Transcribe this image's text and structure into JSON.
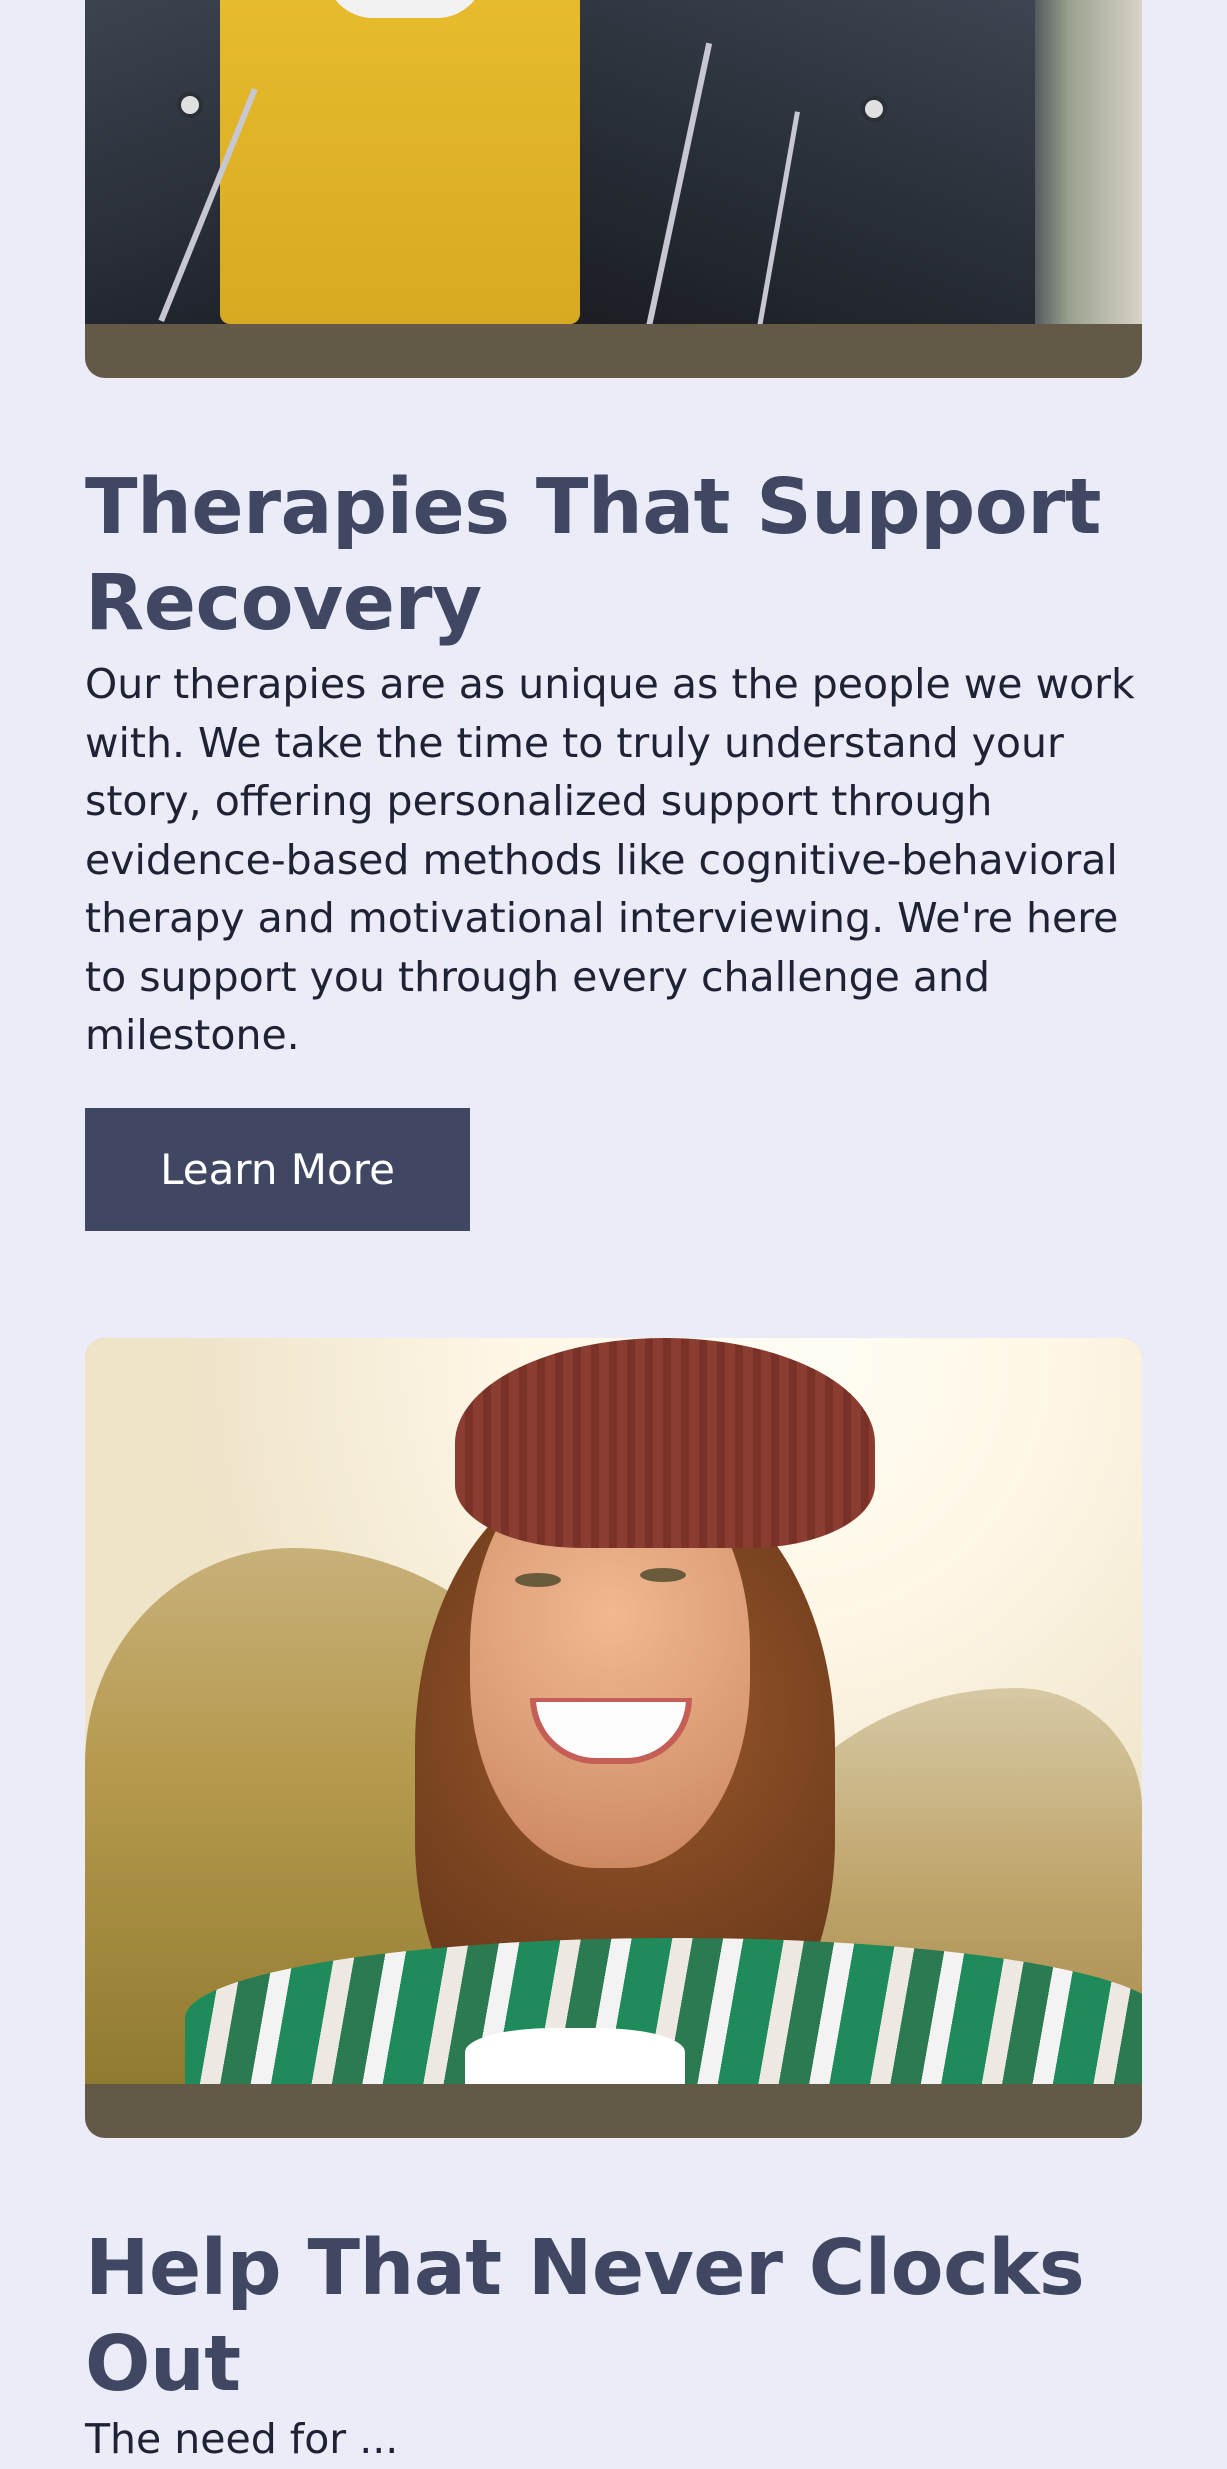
{
  "sections": [
    {
      "image_alt": "person wearing a black leather jacket over a yellow shirt",
      "heading": "Therapies That Support Recovery",
      "body": "Our therapies are as unique as the people we work with. We take the time to truly understand your story, offering personalized support through evidence-based methods like cognitive-behavioral therapy and motivational interviewing. We're here to support you through every challenge and milestone.",
      "button_label": "Learn More"
    },
    {
      "image_alt": "smiling woman with curly hair and red beanie outdoors",
      "heading": "Help That Never Clocks Out",
      "body_visible": "The need for ..."
    }
  ],
  "colors": {
    "page_background": "#ebecf7",
    "heading": "#3f4762",
    "body_text": "#1f2235",
    "button_background": "#3f4762",
    "button_text": "#ffffff",
    "card_footer": "#625946"
  }
}
